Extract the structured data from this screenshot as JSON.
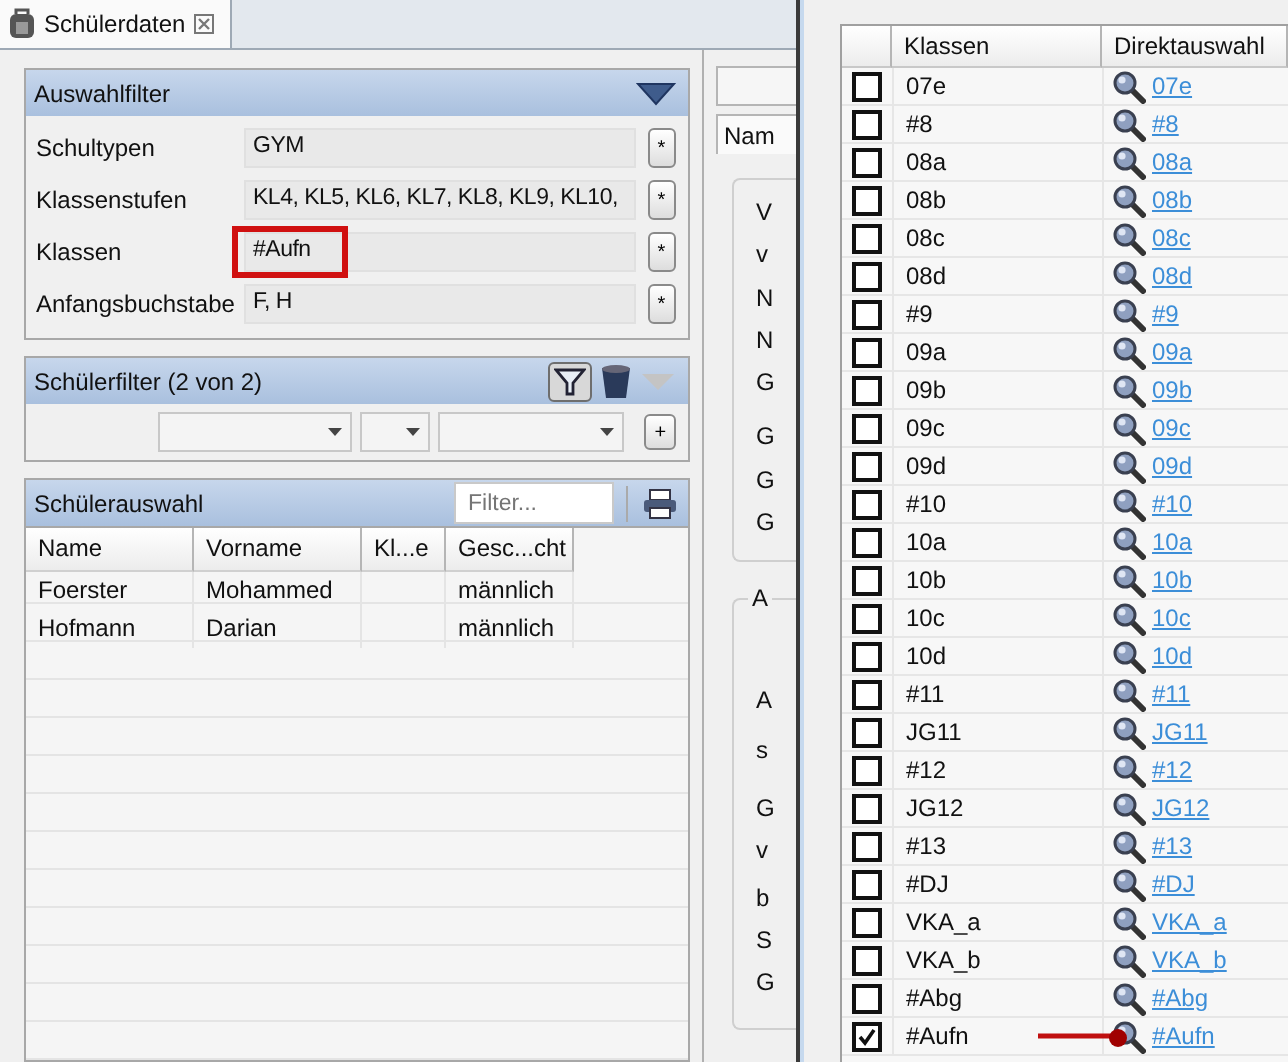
{
  "tab": {
    "title": "Schülerdaten"
  },
  "auswahlfilter": {
    "title": "Auswahlfilter",
    "rows": [
      {
        "label": "Schultypen",
        "value": "GYM",
        "button": "*",
        "highlighted": false
      },
      {
        "label": "Klassenstufen",
        "value": "KL4, KL5, KL6, KL7, KL8, KL9, KL10,",
        "button": "*",
        "highlighted": false
      },
      {
        "label": "Klassen",
        "value": "#Aufn",
        "button": "*",
        "highlighted": true
      },
      {
        "label": "Anfangsbuchstabe",
        "value": "F, H",
        "button": "*",
        "highlighted": false
      }
    ]
  },
  "schuelerfilter": {
    "title": "Schülerfilter (2 von 2)",
    "add_button": "+"
  },
  "schuelerauswahl": {
    "title": "Schülerauswahl",
    "filter_placeholder": "Filter...",
    "columns": [
      "Name",
      "Vorname",
      "Kl...e",
      "Gesc...cht"
    ],
    "rows": [
      {
        "name": "Foerster",
        "first_name": "Mohammed",
        "gender": "männlich"
      },
      {
        "name": "Hofmann",
        "first_name": "Darian",
        "gender": "männlich"
      }
    ]
  },
  "detail_panel": {
    "tab": "Nam",
    "group_1": [
      "V",
      "v",
      "N",
      "N",
      "G",
      "G",
      "G",
      "G"
    ],
    "group_2": {
      "title": "A",
      "labels": [
        "A",
        "s",
        "G",
        "v",
        "b",
        "S",
        "G"
      ]
    }
  },
  "klassen_popup": {
    "columns": [
      "Klassen",
      "Direktauswahl"
    ],
    "rows": [
      {
        "name": "07e",
        "checked": false,
        "link": "07e",
        "annotated": false
      },
      {
        "name": "#8",
        "checked": false,
        "link": "#8",
        "annotated": false
      },
      {
        "name": "08a",
        "checked": false,
        "link": "08a",
        "annotated": false
      },
      {
        "name": "08b",
        "checked": false,
        "link": "08b",
        "annotated": false
      },
      {
        "name": "08c",
        "checked": false,
        "link": "08c",
        "annotated": false
      },
      {
        "name": "08d",
        "checked": false,
        "link": "08d",
        "annotated": false
      },
      {
        "name": "#9",
        "checked": false,
        "link": "#9",
        "annotated": false
      },
      {
        "name": "09a",
        "checked": false,
        "link": "09a",
        "annotated": false
      },
      {
        "name": "09b",
        "checked": false,
        "link": "09b",
        "annotated": false
      },
      {
        "name": "09c",
        "checked": false,
        "link": "09c",
        "annotated": false
      },
      {
        "name": "09d",
        "checked": false,
        "link": "09d",
        "annotated": false
      },
      {
        "name": "#10",
        "checked": false,
        "link": "#10",
        "annotated": false
      },
      {
        "name": "10a",
        "checked": false,
        "link": "10a",
        "annotated": false
      },
      {
        "name": "10b",
        "checked": false,
        "link": "10b",
        "annotated": false
      },
      {
        "name": "10c",
        "checked": false,
        "link": "10c",
        "annotated": false
      },
      {
        "name": "10d",
        "checked": false,
        "link": "10d",
        "annotated": false
      },
      {
        "name": "#11",
        "checked": false,
        "link": "#11",
        "annotated": false
      },
      {
        "name": "JG11",
        "checked": false,
        "link": "JG11",
        "annotated": false
      },
      {
        "name": "#12",
        "checked": false,
        "link": "#12",
        "annotated": false
      },
      {
        "name": "JG12",
        "checked": false,
        "link": "JG12",
        "annotated": false
      },
      {
        "name": "#13",
        "checked": false,
        "link": "#13",
        "annotated": false
      },
      {
        "name": "#DJ",
        "checked": false,
        "link": "#DJ",
        "annotated": false
      },
      {
        "name": "VKA_a",
        "checked": false,
        "link": "VKA_a",
        "annotated": false
      },
      {
        "name": "VKA_b",
        "checked": false,
        "link": "VKA_b",
        "annotated": false
      },
      {
        "name": "#Abg",
        "checked": false,
        "link": "#Abg",
        "annotated": false
      },
      {
        "name": "#Aufn",
        "checked": true,
        "link": "#Aufn",
        "annotated": true
      }
    ]
  }
}
